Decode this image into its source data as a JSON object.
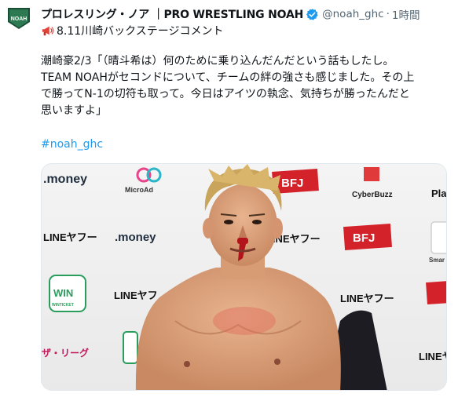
{
  "account": {
    "display_name": "プロレスリング・ノア ｜PRO WRESTLING NOAH",
    "handle": "@noah_ghc",
    "separator": "·",
    "time": "1時間",
    "avatar_icon": "noah-logo",
    "avatar_text": "NOAH",
    "verified_icon": "verified-badge-icon"
  },
  "tweet": {
    "subline_icon": "megaphone-icon",
    "subline": "8.11川崎バックステージコメント",
    "lines": [
      "潮崎豪2/3「（晴斗希は）何のために乗り込んだんだという話もしたし。",
      "TEAM NOAHがセコンドについて、チームの絆の強さも感じました。その上",
      "で勝ってN-1の切符も取って。今日はアイツの執念、気持ちが勝ったんだと",
      "思いますよ」"
    ],
    "hashtag": "#noah_ghc"
  },
  "media": {
    "sponsors": {
      "money": ".money",
      "microad": "MicroAd",
      "bfj": "BFJ",
      "cyberbuzz": "CyberBuzz",
      "line": "LINEヤフー",
      "line_short": "LINEヤフ",
      "win": "WIN",
      "win_sub": "WINTICKET",
      "smart": "Smar",
      "play": "Pla",
      "zleague": "ザ・リーグ"
    }
  },
  "colors": {
    "hashtag": "#1d9bf0",
    "verified": "#1d9bf0",
    "muted": "#536471",
    "avatar_green": "#1a5a3a",
    "bfj_red": "#d4222b"
  }
}
